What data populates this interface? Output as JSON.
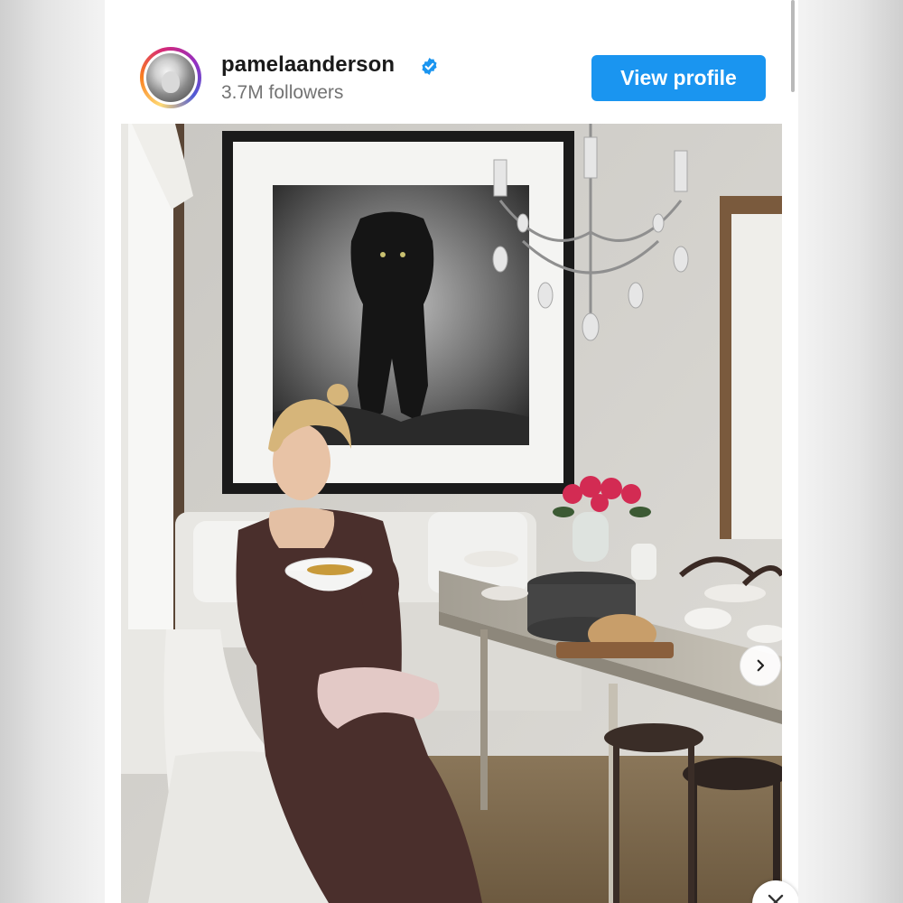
{
  "post": {
    "username": "pamelaanderson",
    "followers": "3.7M followers",
    "verified": true,
    "view_profile_label": "View profile"
  },
  "icons": {
    "verified": "verified-badge-icon",
    "next": "chevron-right-icon",
    "close": "close-icon"
  },
  "colors": {
    "accent": "#1a95f0",
    "verified_badge": "#1a95f0",
    "muted_text": "#737373"
  }
}
